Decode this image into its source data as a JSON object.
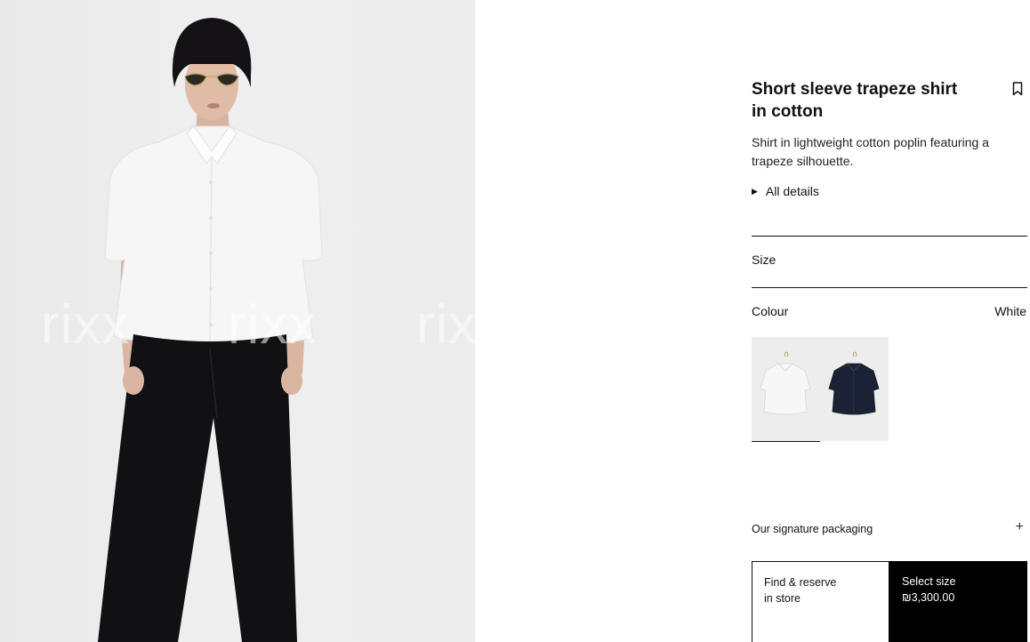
{
  "product": {
    "title_line1": "Short sleeve trapeze shirt",
    "title_line2": "in cotton",
    "description_line1": "Shirt in lightweight cotton poplin featuring a",
    "description_line2": "trapeze silhouette.",
    "details_label": "All details"
  },
  "watermark": "rixx",
  "size": {
    "label": "Size"
  },
  "colour": {
    "label": "Colour",
    "selected_value": "White",
    "swatches": [
      {
        "name": "White",
        "color": "#f4f4f4",
        "selected": true
      },
      {
        "name": "Navy",
        "color": "#1c2236",
        "selected": false
      }
    ]
  },
  "packaging": {
    "label": "Our signature packaging",
    "icon": "plus-icon"
  },
  "actions": {
    "find_line1": "Find & reserve",
    "find_line2": "in store",
    "select_line1": "Select size",
    "select_price": "₪3,300.00"
  },
  "colors": {
    "shirt": "#f6f6f6",
    "trousers": "#111114",
    "hair": "#141214",
    "background": "#ececed"
  }
}
